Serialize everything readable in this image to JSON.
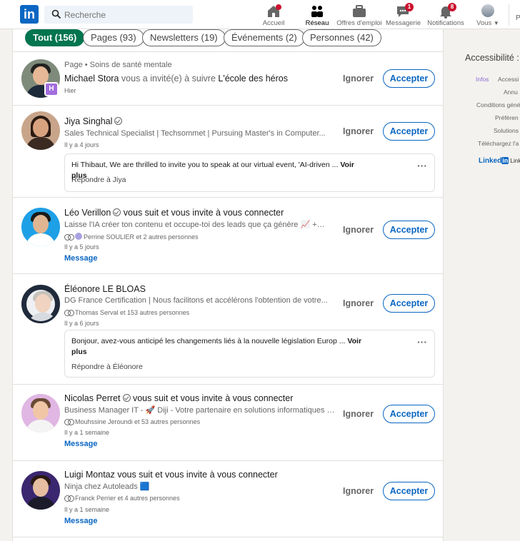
{
  "nav": {
    "logo": "in",
    "search_placeholder": "Recherche",
    "items": [
      {
        "label": "Accueil",
        "badge": ""
      },
      {
        "label": "Réseau",
        "badge": ""
      },
      {
        "label": "Offres d'emploi",
        "badge": ""
      },
      {
        "label": "Messagerie",
        "badge": "1"
      },
      {
        "label": "Notifications",
        "badge": "8"
      },
      {
        "label": "Vous",
        "badge": ""
      }
    ],
    "right_cut": "P"
  },
  "filters": [
    {
      "label": "Tout (156)",
      "active": true
    },
    {
      "label": "Pages (93)"
    },
    {
      "label": "Newsletters (19)"
    },
    {
      "label": "Événements (2)"
    },
    {
      "label": "Personnes (42)"
    }
  ],
  "actions": {
    "ignore": "Ignorer",
    "accept": "Accepter"
  },
  "items": [
    {
      "pre": "Page • Soins de santé mentale",
      "name": "Michael Stora",
      "text": " vous a invité(e) à suivre ",
      "target": "L'école des héros",
      "time": "Hier"
    },
    {
      "name": "Jiya Singhal",
      "subtitle": "Sales Technical Specialist | Techsommet | Pursuing Master's in Computer...",
      "time": "Il y a 4 jours",
      "message": "Hi Thibaut, We are thrilled to invite you to speak at our virtual event, 'AI-driven ...",
      "more": "Voir plus",
      "reply": "Répondre à Jiya"
    },
    {
      "name": "Léo Verillon",
      "text": " vous suit et vous invite à vous connecter",
      "subtitle": "Laisse l'IA créer ton contenu et occupe-toi des leads que ça génère 📈 +170K...",
      "mutual": "Perrine SOULIER et 2 autres personnes",
      "time": "Il y a 5 jours",
      "link": "Message"
    },
    {
      "name": "Éléonore LE BLOAS",
      "subtitle": "DG France Certification | Nous facilitons et accélérons l'obtention de votre...",
      "mutual": "Thomas Serval et 153 autres personnes",
      "time": "Il y a 6 jours",
      "message": "Bonjour, avez-vous anticipé les changements liés à la nouvelle législation Europ ...",
      "more": "Voir plus",
      "reply": "Répondre à Éléonore"
    },
    {
      "name": "Nicolas Perret",
      "text": " vous suit et vous invite à vous connecter",
      "subtitle": "Business Manager IT - 🚀 Diji - Votre partenaire en solutions informatiques 🚀",
      "mutual": "Mouhssine Jeroundi et 53 autres personnes",
      "time": "Il y a 1 semaine",
      "link": "Message"
    },
    {
      "name": "Luigi Montaz",
      "text": " vous suit et vous invite à vous connecter",
      "subtitle": "Ninja chez Autoleads 🟦",
      "mutual": "Franck Perrier et 4 autres personnes",
      "time": "Il y a 1 semaine",
      "link": "Message"
    }
  ],
  "rail": {
    "title": "Accessibilité : p",
    "links": [
      "Infos",
      "Accessi",
      "Annu",
      "Conditions géné",
      "Préféren",
      "Solutions",
      "Téléchargez l'a"
    ],
    "brand": "Linked",
    "brand_in": "in",
    "brand_tail": "Link"
  }
}
